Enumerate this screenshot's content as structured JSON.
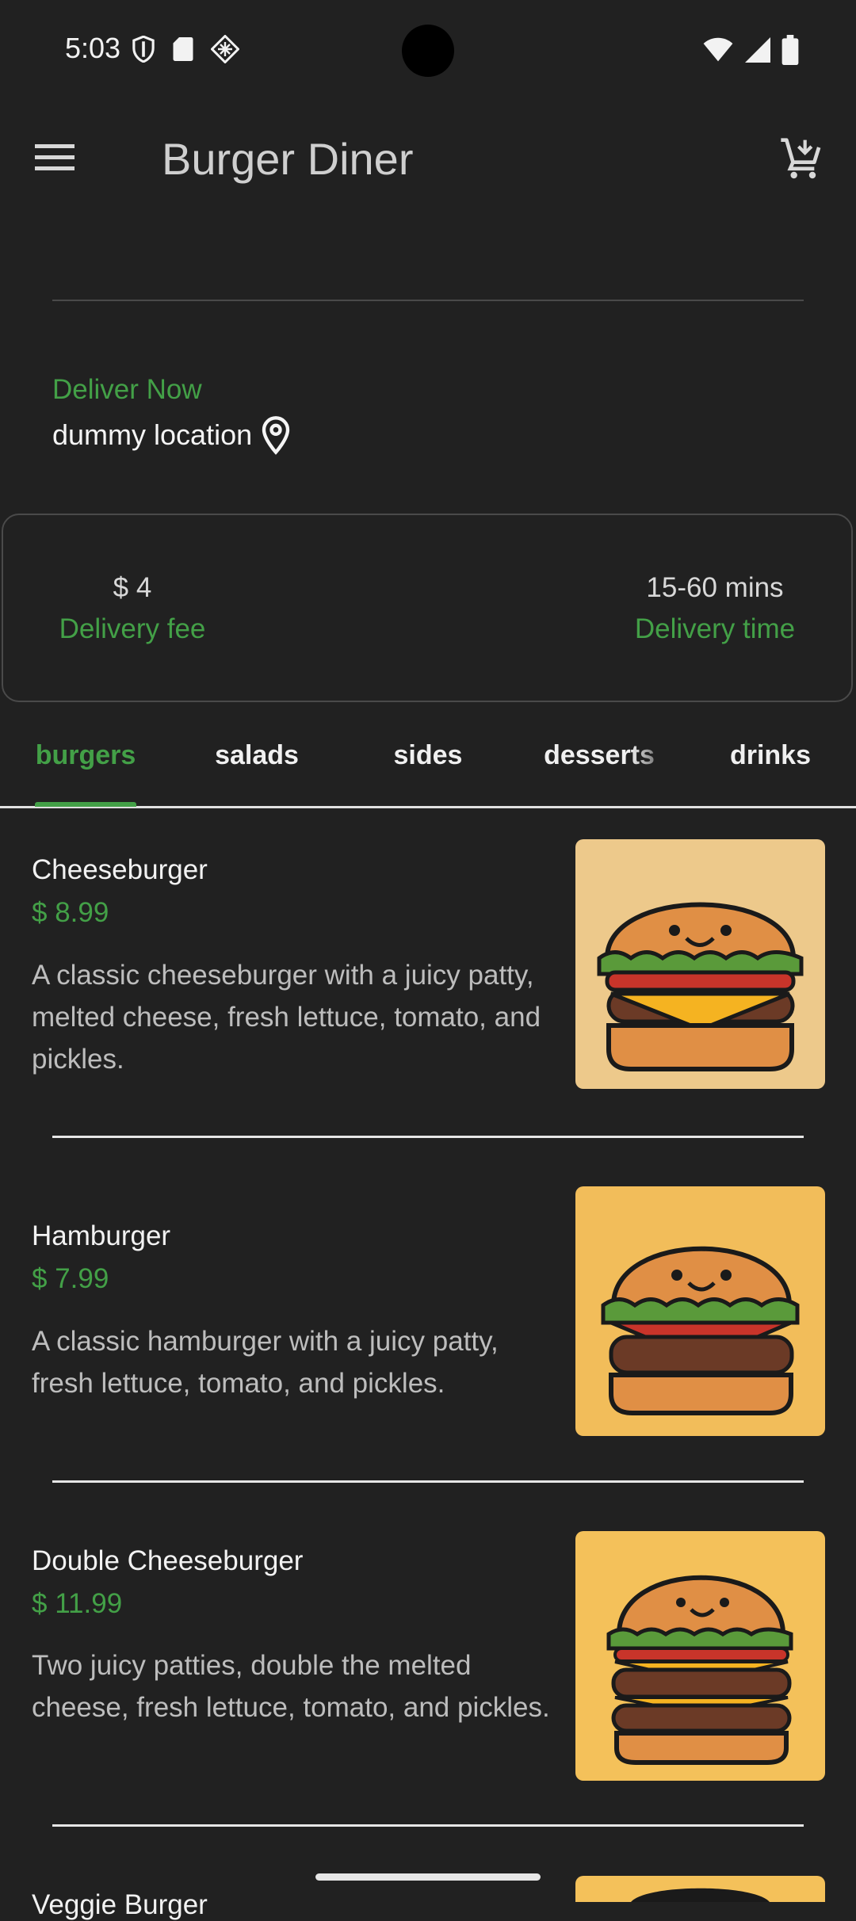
{
  "status_bar": {
    "time": "5:03"
  },
  "app_bar": {
    "title": "Burger Diner"
  },
  "delivery": {
    "mode": "Deliver Now",
    "location": "dummy location",
    "fee_value": "$ 4",
    "fee_label": "Delivery fee",
    "time_value": "15-60 mins",
    "time_label": "Delivery time"
  },
  "tabs": [
    {
      "label": "burgers",
      "active": true
    },
    {
      "label": "salads"
    },
    {
      "label": "sides"
    },
    {
      "label": "desserts"
    },
    {
      "label": "drinks"
    }
  ],
  "items": [
    {
      "name": "Cheeseburger",
      "price": "$ 8.99",
      "description": "A classic cheeseburger with a juicy patty, melted cheese, fresh lettuce, tomato, and pickles.",
      "image_bg": "#edc98b"
    },
    {
      "name": "Hamburger",
      "price": "$ 7.99",
      "description": "A classic hamburger with a juicy patty, fresh lettuce, tomato, and pickles.",
      "image_bg": "#f2bd5a"
    },
    {
      "name": "Double Cheeseburger",
      "price": "$ 11.99",
      "description": "Two juicy patties, double the melted cheese, fresh lettuce, tomato, and pickles.",
      "image_bg": "#f4c15a"
    },
    {
      "name": "Veggie Burger",
      "price": "",
      "description": "",
      "image_bg": "#f4c15a"
    }
  ],
  "colors": {
    "accent": "#43a047",
    "background": "#212121"
  }
}
